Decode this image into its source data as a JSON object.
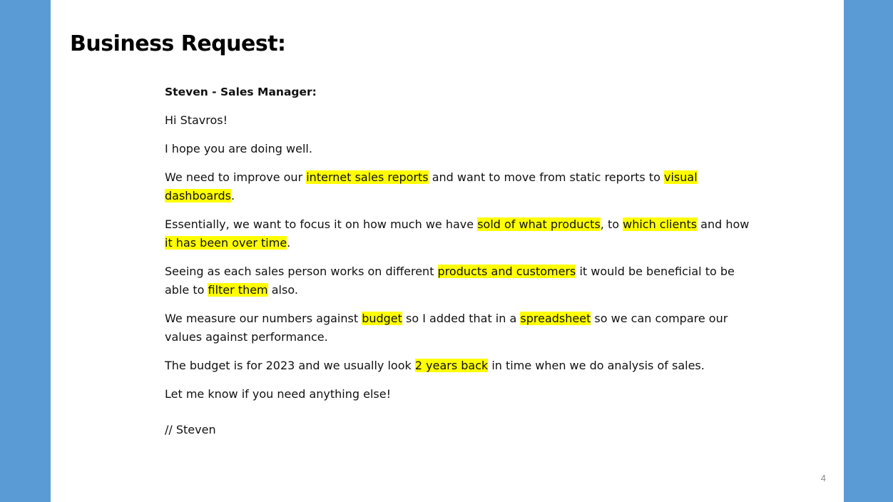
{
  "colors": {
    "side_panel": "#5b9bd5",
    "slide_bg": "#ffffff",
    "highlight": "#ffff00",
    "text": "#111111",
    "page_number": "#8a8a8a"
  },
  "slide": {
    "title": "Business Request:",
    "page_number": "4"
  },
  "email": {
    "sender": "Steven - Sales Manager:",
    "greeting": "Hi Stavros!",
    "p1": "I hope you are doing well.",
    "p2": {
      "t1": "We need to improve our ",
      "h1": "internet sales reports",
      "t2": " and want to move from static reports to ",
      "h2": "visual dashboards",
      "t3": "."
    },
    "p3": {
      "t1": "Essentially, we want to focus it on how much we have ",
      "h1": "sold of what products",
      "t2": ", to ",
      "h2": "which clients",
      "t3": " and how ",
      "h3": "it has been over time",
      "t4": "."
    },
    "p4": {
      "t1": "Seeing as each sales person works on different ",
      "h1": "products and customers",
      "t2": " it would be beneficial to be able to ",
      "h2": "filter them",
      "t3": " also."
    },
    "p5": {
      "t1": "We measure our numbers against ",
      "h1": "budget",
      "t2": " so I added that in a ",
      "h2": "spreadsheet",
      "t3": " so we can compare our values against performance."
    },
    "p6": {
      "t1": "The budget is for 2023 and we usually look ",
      "h1": "2 years back",
      "t2": " in time when we do analysis of sales."
    },
    "p7": "Let me know if you need anything else!",
    "signoff": "// Steven"
  }
}
